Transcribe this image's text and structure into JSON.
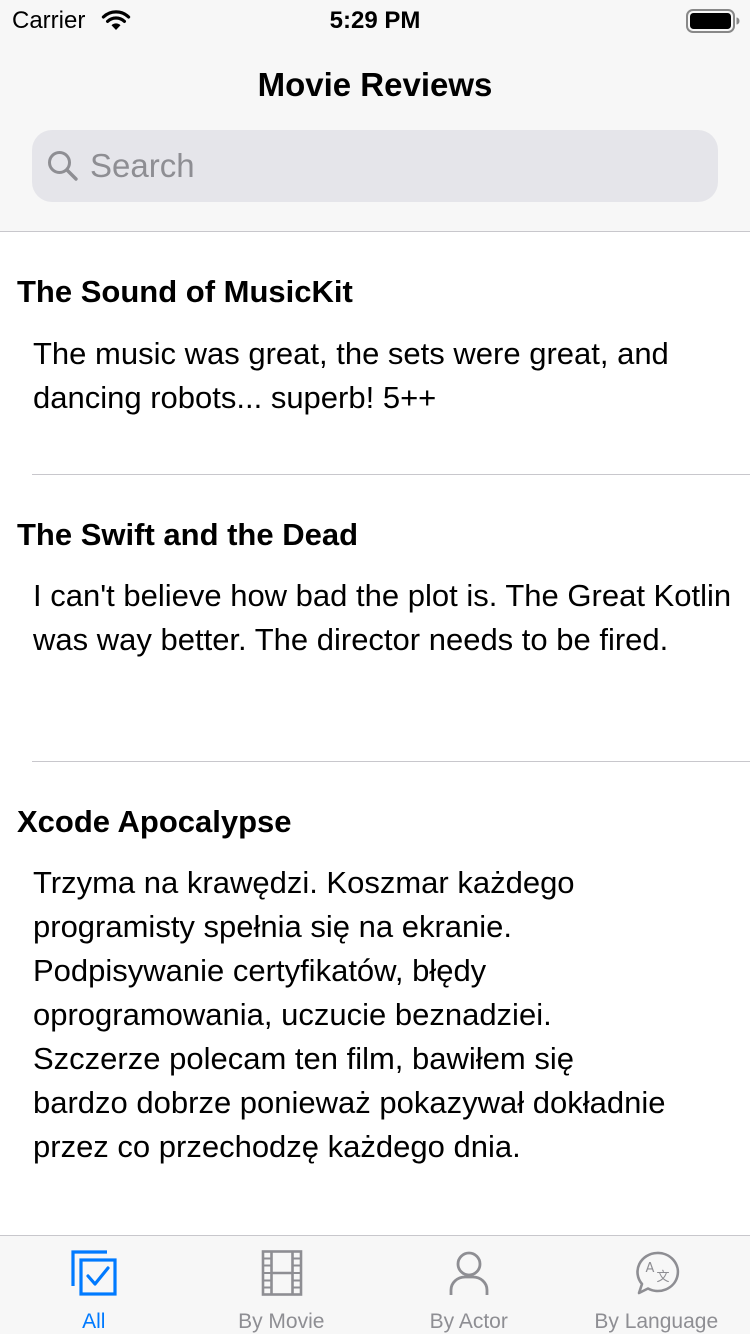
{
  "status_bar": {
    "carrier": "Carrier",
    "time": "5:29 PM",
    "wifi_icon": "wifi-icon",
    "battery_icon": "battery-icon"
  },
  "nav": {
    "title": "Movie Reviews"
  },
  "search": {
    "placeholder": "Search",
    "value": "",
    "icon": "search-icon"
  },
  "reviews": [
    {
      "title": "The Sound of MusicKit",
      "body": "The music was great, the sets were great, and dancing robots... superb! 5++"
    },
    {
      "title": "The Swift and the Dead",
      "body": "I can't believe how bad the plot is. The Great Kotlin was way better. The director needs to be fired."
    },
    {
      "title": "Xcode Apocalypse",
      "body": "Trzyma na krawędzi. Koszmar każdego programisty spełnia się na ekranie. Podpisywanie certyfikatów, błędy oprogramowania, uczucie beznadziei. Szczerze polecam ten film, bawiłem się bardzo dobrze ponieważ pokazywał dokładnie przez co przechodzę każdego dnia."
    }
  ],
  "tabs": [
    {
      "label": "All",
      "icon": "checkbox-stack-icon",
      "selected": true
    },
    {
      "label": "By Movie",
      "icon": "film-icon",
      "selected": false
    },
    {
      "label": "By Actor",
      "icon": "person-icon",
      "selected": false
    },
    {
      "label": "By Language",
      "icon": "translate-icon",
      "selected": false
    }
  ],
  "colors": {
    "accent": "#007aff",
    "inactive": "#8e8e93",
    "bar_background": "#f7f7f7",
    "search_background": "#e5e5ea",
    "separator": "#c8c7cc"
  }
}
